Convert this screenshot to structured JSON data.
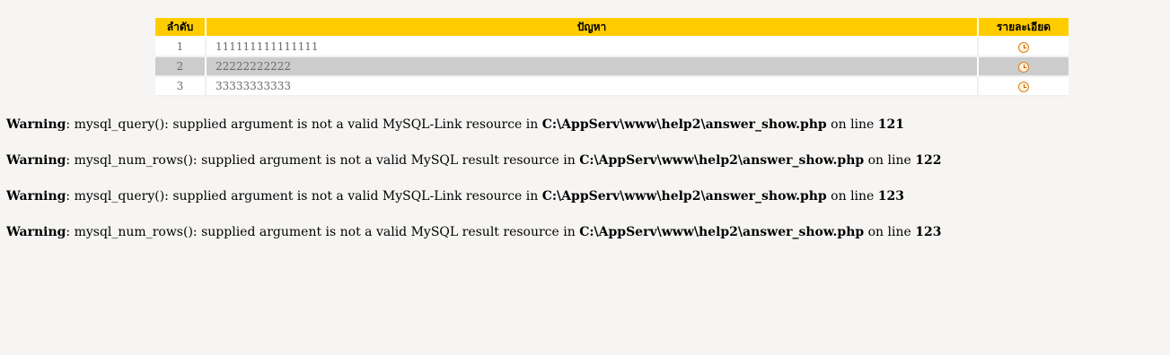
{
  "table": {
    "headers": {
      "no": "ลำดับ",
      "problem": "ปัญหา",
      "detail": "รายละเอียด"
    },
    "rows": [
      {
        "no": "1",
        "problem": "111111111111111",
        "detail_icon": "clock-icon"
      },
      {
        "no": "2",
        "problem": "22222222222",
        "detail_icon": "clock-icon"
      },
      {
        "no": "3",
        "problem": "33333333333",
        "detail_icon": "clock-icon"
      }
    ],
    "header_color": "#ffcc00",
    "alt_row_color": "#cccccc"
  },
  "warnings": [
    {
      "label": "Warning",
      "message": ": mysql_query(): supplied argument is not a valid MySQL-Link resource in ",
      "file": "C:\\AppServ\\www\\help2\\answer_show.php",
      "on_line": " on line ",
      "line": "121"
    },
    {
      "label": "Warning",
      "message": ": mysql_num_rows(): supplied argument is not a valid MySQL result resource in ",
      "file": "C:\\AppServ\\www\\help2\\answer_show.php",
      "on_line": " on line ",
      "line": "122"
    },
    {
      "label": "Warning",
      "message": ": mysql_query(): supplied argument is not a valid MySQL-Link resource in ",
      "file": "C:\\AppServ\\www\\help2\\answer_show.php",
      "on_line": " on line ",
      "line": "123"
    },
    {
      "label": "Warning",
      "message": ": mysql_num_rows(): supplied argument is not a valid MySQL result resource in ",
      "file": "C:\\AppServ\\www\\help2\\answer_show.php",
      "on_line": " on line ",
      "line": "123"
    }
  ]
}
